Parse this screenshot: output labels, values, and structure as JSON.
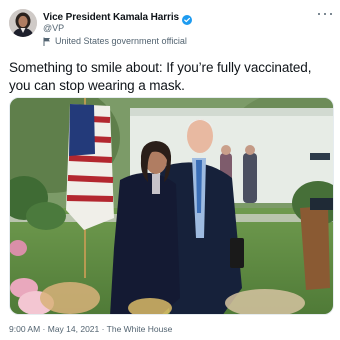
{
  "tweet": {
    "display_name": "Vice President Kamala Harris",
    "handle": "@VP",
    "account_label": "United States government official",
    "text": "Something to smile about: If you’re fully vaccinated, you can stop wearing a mask.",
    "timestamp": "9:00 AM · May 14, 2021 · The White House",
    "verified_color": "#1d9bf0",
    "icons": {
      "verified": "verified-badge-icon",
      "label": "flag-icon",
      "more": "more-options-icon"
    }
  }
}
